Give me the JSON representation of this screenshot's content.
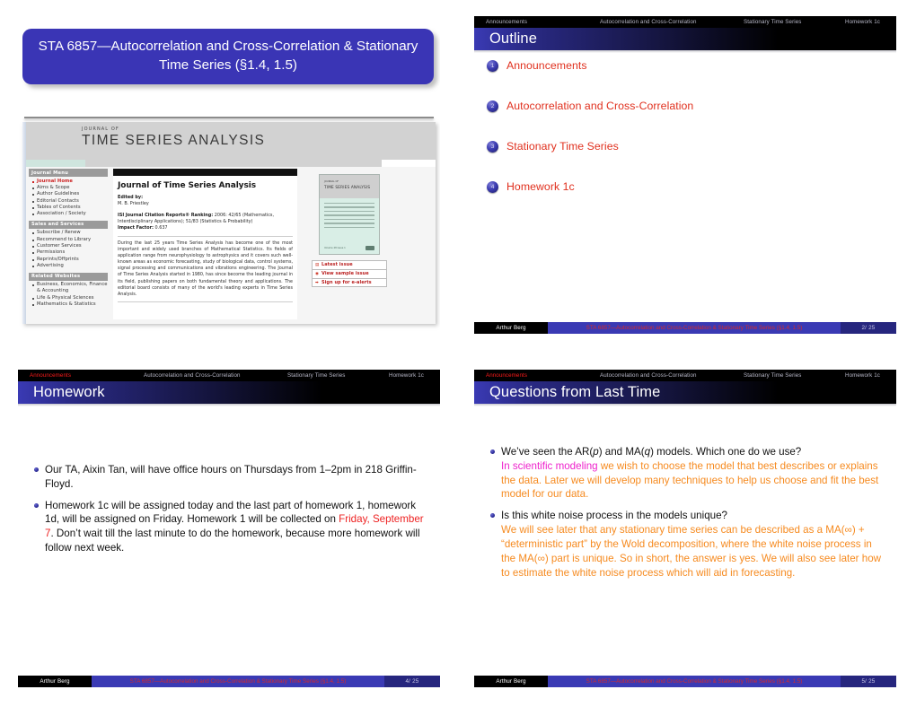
{
  "deck": {
    "author": "Arthur Berg",
    "footer_title": "STA 6857—Autocorrelation and Cross-Correlation & Stationary Time Series (§1.4, 1.5)",
    "nav": [
      "Announcements",
      "Autocorrelation and Cross-Correlation",
      "Stationary Time Series",
      "Homework 1c"
    ]
  },
  "slide_title": {
    "title": "STA 6857—Autocorrelation and Cross-Correlation & Stationary Time Series (§1.4, 1.5)",
    "journal": {
      "journal_of": "JOURNAL OF",
      "masthead": "TIME  SERIES  ANALYSIS",
      "menu": [
        {
          "header": "Journal Menu",
          "items": [
            {
              "label": "Journal Home",
              "highlight": true
            },
            {
              "label": "Aims & Scope",
              "highlight": false
            },
            {
              "label": "Author Guidelines",
              "highlight": false
            },
            {
              "label": "Editorial Contacts",
              "highlight": false
            },
            {
              "label": "Tables of Contents",
              "highlight": false
            },
            {
              "label": "Association / Society",
              "highlight": false
            }
          ]
        },
        {
          "header": "Sales and Services",
          "items": [
            {
              "label": "Subscribe / Renew",
              "highlight": false
            },
            {
              "label": "Recommend to Library",
              "highlight": false
            },
            {
              "label": "Customer Services",
              "highlight": false
            },
            {
              "label": "Permissions",
              "highlight": false
            },
            {
              "label": "Reprints/Offprints",
              "highlight": false
            },
            {
              "label": "Advertising",
              "highlight": false
            }
          ]
        },
        {
          "header": "Related Websites",
          "items": [
            {
              "label": "Business, Economics, Finance & Accounting",
              "highlight": false
            },
            {
              "label": "Life & Physical Sciences",
              "highlight": false
            },
            {
              "label": "Mathematics & Statistics",
              "highlight": false
            }
          ]
        }
      ],
      "heading": "Journal of Time Series Analysis",
      "edited_by_label": "Edited by:",
      "editor": "M. B. Priestley",
      "ranking_label": "ISI Journal Citation Reports® Ranking:",
      "ranking_value": "2006: 42/65 (Mathematics, Interdisciplinary Applications); 51/83 (Statistics & Probability)",
      "impact_label": "Impact Factor:",
      "impact_value": "0.637",
      "abstract": "During the last 25 years Time Series Analysis has become one of the most important and widely used branches of Mathematical Statistics. Its fields of application range from neurophysiology to astrophysics and it covers such well-known areas as economic forecasting, study of biological data, control systems, signal processing and communications and vibrations engineering. The Journal of Time Series Analysis started in 1980, has since become the leading journal in its field, publishing papers on both fundamental theory and applications. The editorial board consists of many of the world's leading experts in Time Series Analysis.",
      "cover_top_small": "JOURNAL OF",
      "cover_top_title": "TIME  SERIES ANALYSIS",
      "cover_vol": "Volume 28  Issue 1",
      "links": [
        {
          "icon": "page-icon",
          "glyph": "▤",
          "label": "Latest issue"
        },
        {
          "icon": "eye-icon",
          "glyph": "◉",
          "label": "View sample issue"
        },
        {
          "icon": "arrow-icon",
          "glyph": "➡",
          "label": "Sign up for e-alerts"
        }
      ]
    }
  },
  "slide_outline": {
    "frame_title": "Outline",
    "page": "2/ 25",
    "active_nav_index": -1,
    "items": [
      {
        "num": "1",
        "label": "Announcements"
      },
      {
        "num": "2",
        "label": "Autocorrelation and Cross-Correlation"
      },
      {
        "num": "3",
        "label": "Stationary Time Series"
      },
      {
        "num": "4",
        "label": "Homework 1c"
      }
    ]
  },
  "slide_homework": {
    "frame_title": "Homework",
    "page": "4/ 25",
    "active_nav_index": 0,
    "bullets": [
      {
        "parts": [
          {
            "text": "Our TA, Aixin Tan, will have office hours on Thursdays from 1–2pm in 218 Griffin-Floyd.",
            "style": "plain"
          }
        ]
      },
      {
        "parts": [
          {
            "text": "Homework 1c will be assigned today and the last part of homework 1, homework 1d, will be assigned on Friday. Homework 1 will be collected on ",
            "style": "plain"
          },
          {
            "text": "Friday, September 7",
            "style": "red"
          },
          {
            "text": ". Don’t wait till the last minute to do the homework, because more homework will follow next week.",
            "style": "plain"
          }
        ]
      }
    ]
  },
  "slide_questions": {
    "frame_title": "Questions from Last Time",
    "page": "5/ 25",
    "active_nav_index": 0,
    "bullets": [
      {
        "parts": [
          {
            "text": "We’ve seen the AR(",
            "style": "plain"
          },
          {
            "text": "p",
            "style": "italic"
          },
          {
            "text": ") and MA(",
            "style": "plain"
          },
          {
            "text": "q",
            "style": "italic"
          },
          {
            "text": ") models. Which one do we use?",
            "style": "plain"
          },
          {
            "text": "\n",
            "style": "break"
          },
          {
            "text": "In scientific modeling",
            "style": "magenta"
          },
          {
            "text": " we wish to choose the model that best describes or explains the data. Later we will develop many techniques to help us choose and fit the best model for our data.",
            "style": "orange"
          }
        ]
      },
      {
        "parts": [
          {
            "text": "Is this white noise process in the models unique?",
            "style": "plain"
          },
          {
            "text": "\n",
            "style": "break"
          },
          {
            "text": "We will see later that any stationary time series can be described as a MA(∞) + “deterministic part” by the Wold decomposition, where the white noise process in the MA(∞) part is unique. So in short, the answer is yes. We will also see later how to estimate the white noise process which will aid in forecasting.",
            "style": "orange"
          }
        ]
      }
    ]
  },
  "colors": {
    "beamer_blue": "#3a35b5",
    "accent_red": "#e0301e",
    "accent_orange": "#f68a1f",
    "accent_magenta": "#ee22cc",
    "footer_blue": "#3a3ab4"
  }
}
